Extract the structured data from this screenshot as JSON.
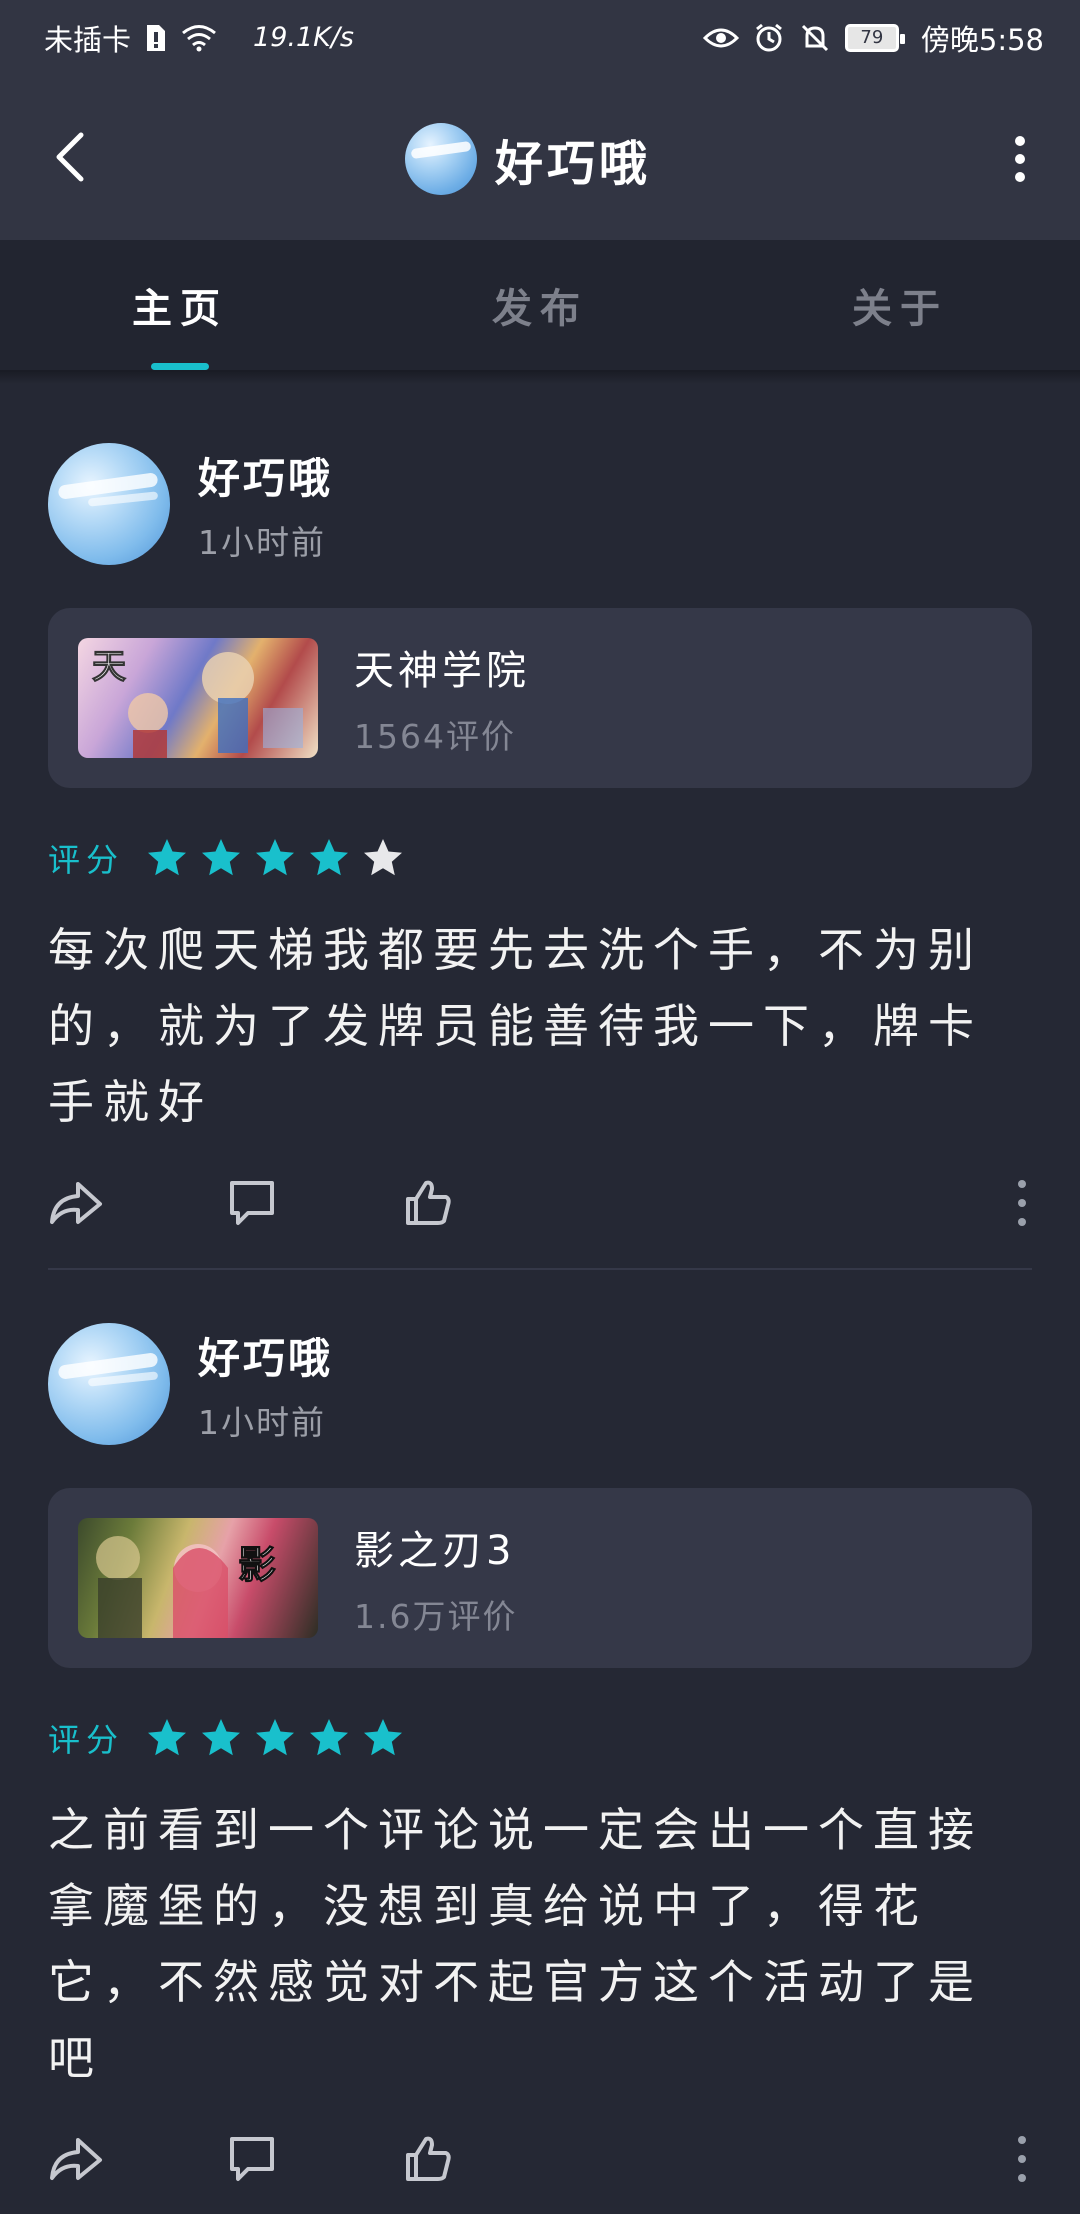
{
  "status_bar": {
    "carrier": "未插卡",
    "speed": "19.1K/s",
    "battery": "79",
    "time": "傍晚5:58"
  },
  "header": {
    "title": "好巧哦"
  },
  "tabs": [
    {
      "label": "主页",
      "active": true
    },
    {
      "label": "发布",
      "active": false
    },
    {
      "label": "关于",
      "active": false
    }
  ],
  "posts": [
    {
      "username": "好巧哦",
      "time": "1小时前",
      "game": {
        "name": "天神学院",
        "reviews": "1564评价"
      },
      "rating_label": "评分",
      "rating": 4,
      "body": "每次爬天梯我都要先去洗个手，不为别的，就为了发牌员能善待我一下，牌卡手就好"
    },
    {
      "username": "好巧哦",
      "time": "1小时前",
      "game": {
        "name": "影之刃3",
        "reviews": "1.6万评价"
      },
      "rating_label": "评分",
      "rating": 5,
      "body": "之前看到一个评论说一定会出一个直接拿魔堡的，没想到真给说中了，得花它，不然感觉对不起官方这个活动了是吧"
    }
  ],
  "colors": {
    "accent": "#19c0cc",
    "background": "#252834",
    "card": "#353848",
    "header": "#323543"
  }
}
